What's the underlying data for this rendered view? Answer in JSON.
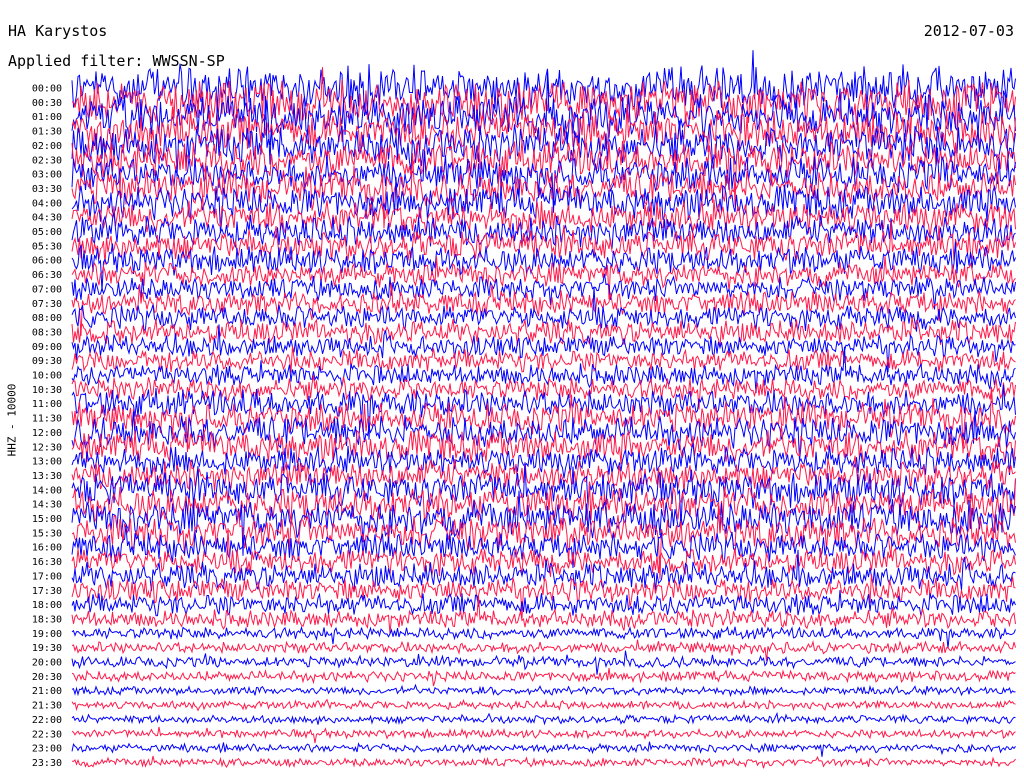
{
  "header": {
    "station": "HA Karystos",
    "date": "2012-07-03",
    "filter": "Applied filter: WWSSN-SP"
  },
  "channel_label": "HHZ - 10000",
  "colors": {
    "trace_a": "#0000ff",
    "trace_b": "#ff1a4a"
  },
  "chart_data": {
    "type": "line",
    "title": "HA Karystos",
    "subtitle": "Applied filter: WWSSN-SP",
    "ylabel": "HHZ - 10000",
    "y_tick_labels": [
      "00:00",
      "00:30",
      "01:00",
      "01:30",
      "02:00",
      "02:30",
      "03:00",
      "03:30",
      "04:00",
      "04:30",
      "05:00",
      "05:30",
      "06:00",
      "06:30",
      "07:00",
      "07:30",
      "08:00",
      "08:30",
      "09:00",
      "09:30",
      "10:00",
      "10:30",
      "11:00",
      "11:30",
      "12:00",
      "12:30",
      "13:00",
      "13:30",
      "14:00",
      "14:30",
      "15:00",
      "15:30",
      "16:00",
      "16:30",
      "17:00",
      "17:30",
      "18:00",
      "18:30",
      "19:00",
      "19:30",
      "20:00",
      "20:30",
      "21:00",
      "21:30",
      "22:00",
      "22:30",
      "23:00",
      "23:30"
    ],
    "series_colors": [
      "#0000ff",
      "#ff1a4a"
    ],
    "amplitude": [
      1.0,
      1.0,
      0.95,
      0.9,
      0.85,
      0.8,
      0.75,
      0.75,
      0.75,
      0.7,
      0.65,
      0.65,
      0.6,
      0.5,
      0.5,
      0.5,
      0.5,
      0.5,
      0.45,
      0.45,
      0.45,
      0.45,
      0.6,
      0.65,
      0.7,
      0.7,
      0.6,
      0.65,
      0.75,
      0.75,
      0.8,
      0.75,
      0.6,
      0.55,
      0.55,
      0.5,
      0.45,
      0.35,
      0.2,
      0.2,
      0.18,
      0.18,
      0.12,
      0.12,
      0.12,
      0.12,
      0.12,
      0.12
    ],
    "grid": false
  }
}
